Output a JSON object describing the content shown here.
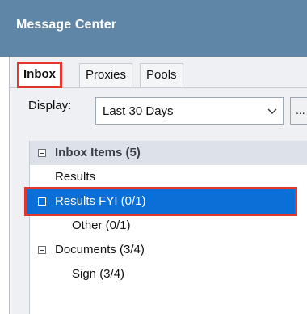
{
  "window": {
    "title": "Message Center"
  },
  "tabs": [
    {
      "label": "Inbox",
      "active": true
    },
    {
      "label": "Proxies",
      "active": false
    },
    {
      "label": "Pools",
      "active": false
    }
  ],
  "display": {
    "label": "Display:",
    "value": "Last 30 Days",
    "more_label": "..."
  },
  "tree": {
    "root": {
      "label": "Inbox Items (5)",
      "expanded": true
    },
    "items": [
      {
        "label": "Results"
      },
      {
        "label": "Results FYI (0/1)",
        "expanded": true,
        "selected": true
      },
      {
        "label": "Other (0/1)"
      },
      {
        "label": "Documents (3/4)",
        "expanded": true
      },
      {
        "label": "Sign (3/4)"
      }
    ]
  },
  "colors": {
    "titlebar": "#5f85a7",
    "selection": "#0a6fd6",
    "highlight": "#e2362f"
  }
}
